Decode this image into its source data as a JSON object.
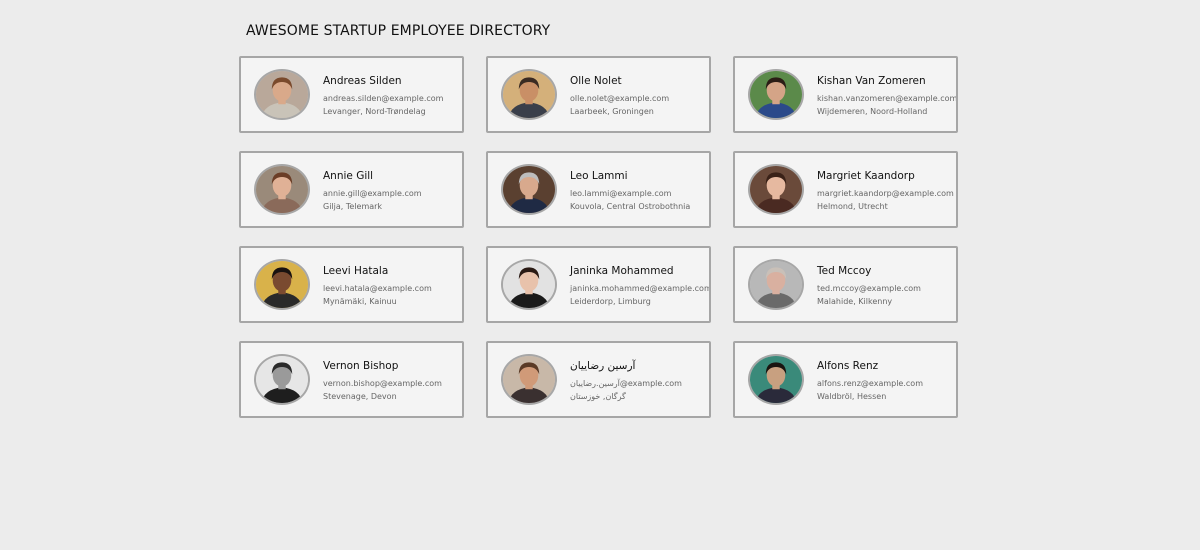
{
  "page": {
    "title": "AWESOME STARTUP EMPLOYEE DIRECTORY"
  },
  "colors": {
    "background": "#ececec",
    "card_background": "#f4f4f4",
    "card_border": "#a6a6a6",
    "name_text": "#111111",
    "detail_text": "#666666"
  },
  "employees": [
    {
      "name": "Andreas Silden",
      "email": "andreas.silden@example.com",
      "location": "Levanger, Nord-Trøndelag",
      "skin": "#d9a98a",
      "hair": "#7a4a2c",
      "shirt": "#c9c3b8",
      "bg": "#b9a89a"
    },
    {
      "name": "Olle Nolet",
      "email": "olle.nolet@example.com",
      "location": "Laarbeek, Groningen",
      "skin": "#c98f66",
      "hair": "#3a2a22",
      "shirt": "#3a3f4a",
      "bg": "#d4b07a"
    },
    {
      "name": "Kishan Van Zomeren",
      "email": "kishan.vanzomeren@example.com",
      "location": "Wijdemeren, Noord-Holland",
      "skin": "#d4a487",
      "hair": "#2b1d16",
      "shirt": "#2b4a8a",
      "bg": "#5b8a4a"
    },
    {
      "name": "Annie Gill",
      "email": "annie.gill@example.com",
      "location": "Gilja, Telemark",
      "skin": "#e0b196",
      "hair": "#6b3d26",
      "shirt": "#8a6a5a",
      "bg": "#9a8a7a"
    },
    {
      "name": "Leo Lammi",
      "email": "leo.lammi@example.com",
      "location": "Kouvola, Central Ostrobothnia",
      "skin": "#d8a98d",
      "hair": "#bdbdbd",
      "shirt": "#1f2a44",
      "bg": "#5a4030"
    },
    {
      "name": "Margriet Kaandorp",
      "email": "margriet.kaandorp@example.com",
      "location": "Helmond, Utrecht",
      "skin": "#e6b9a0",
      "hair": "#3a2218",
      "shirt": "#4a2a22",
      "bg": "#6a4a3a"
    },
    {
      "name": "Leevi Hatala",
      "email": "leevi.hatala@example.com",
      "location": "Mynämäki, Kainuu",
      "skin": "#7a4a30",
      "hair": "#1a1210",
      "shirt": "#2a2a2a",
      "bg": "#d9b24a"
    },
    {
      "name": "Janinka Mohammed",
      "email": "janinka.mohammed@example.com",
      "location": "Leiderdorp, Limburg",
      "skin": "#e8c2ab",
      "hair": "#2a1a14",
      "shirt": "#1a1a1a",
      "bg": "#e2e2e2"
    },
    {
      "name": "Ted Mccoy",
      "email": "ted.mccoy@example.com",
      "location": "Malahide, Kilkenny",
      "skin": "#d9b0a0",
      "hair": "#c9c0b8",
      "shirt": "#6a6a6a",
      "bg": "#b8b8b8"
    },
    {
      "name": "Vernon Bishop",
      "email": "vernon.bishop@example.com",
      "location": "Stevenage, Devon",
      "skin": "#9a9a9a",
      "hair": "#2a2a2a",
      "shirt": "#1e1e1e",
      "bg": "#e6e6e6"
    },
    {
      "name": "آرسین رضاییان",
      "email": "آرسین.رضاییان@example.com",
      "location": "گرگان, خوزستان",
      "skin": "#d09a78",
      "hair": "#5a3a26",
      "shirt": "#3a3030",
      "bg": "#c8b8a8"
    },
    {
      "name": "Alfons Renz",
      "email": "alfons.renz@example.com",
      "location": "Waldbröl, Hessen",
      "skin": "#c8a080",
      "hair": "#1a1410",
      "shirt": "#2a2a3a",
      "bg": "#3a8a7a"
    }
  ]
}
